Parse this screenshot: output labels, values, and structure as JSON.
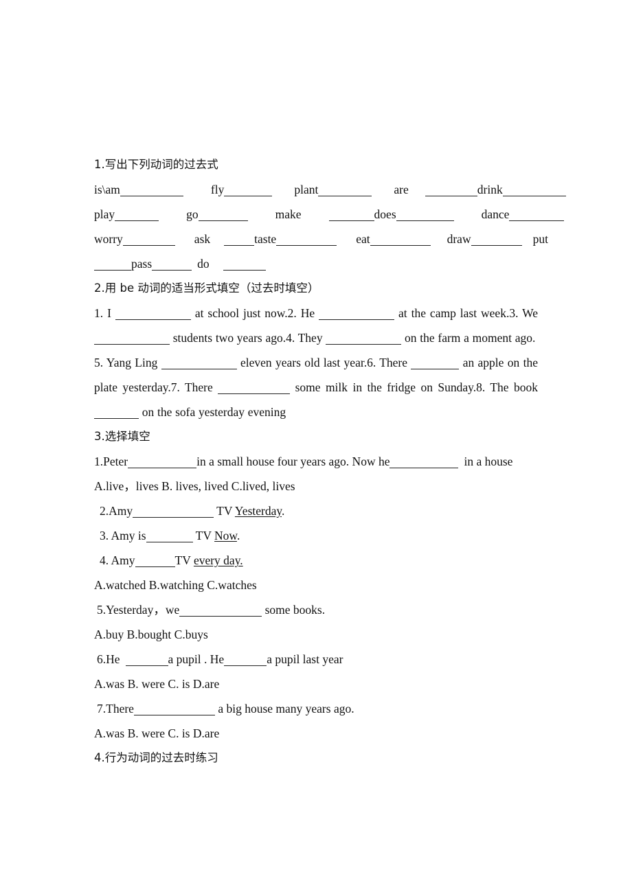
{
  "document": {
    "language": "zh-CN / en",
    "sections": [
      {
        "id": "section-1",
        "heading": "1.写出下列动词的过去式",
        "rows": [
          {
            "id": "verbs-row-1",
            "items": [
              "is\\am",
              "fly",
              "plant",
              "are",
              "drink"
            ]
          },
          {
            "id": "verbs-row-2",
            "items": [
              "play",
              "go",
              "make",
              "does",
              "dance"
            ]
          },
          {
            "id": "verbs-row-3",
            "items": [
              "worry",
              "ask",
              "taste",
              "eat",
              "draw",
              "put"
            ]
          },
          {
            "id": "verbs-row-4",
            "items": [
              "pass",
              "do"
            ]
          }
        ]
      },
      {
        "id": "section-2",
        "heading": "2.用 be 动词的适当形式填空（过去时填空）",
        "paragraphs": [
          {
            "id": "be-para-1",
            "parts": [
              {
                "t": "1. I"
              },
              {
                "blank": 110
              },
              {
                "t": "at school just now.2. He"
              },
              {
                "blank": 110
              },
              {
                "t": "at the camp last week.3. We"
              },
              {
                "blank": 110
              },
              {
                "t": "students two years ago.4. They"
              },
              {
                "blank": 110
              },
              {
                "t": "on the farm a moment ago."
              }
            ]
          },
          {
            "id": "be-para-2",
            "parts": [
              {
                "t": "5. Yang Ling"
              },
              {
                "blank": 110
              },
              {
                "t": "eleven years old last year.6. There"
              },
              {
                "blank": 70
              },
              {
                "t": "an apple on the plate yesterday.7. There"
              },
              {
                "blank": 105
              },
              {
                "t": "some milk in the fridge on Sunday.8. The book"
              },
              {
                "blank": 65
              },
              {
                "t": "on the sofa yesterday evening"
              }
            ]
          }
        ]
      },
      {
        "id": "section-3",
        "heading": "3.选择填空",
        "questions": [
          {
            "id": "q1",
            "stem_before": "1.Peter",
            "blank1": 100,
            "stem_mid": "in a small house four years ago. Now he",
            "blank2": 100,
            "stem_after": "in a house",
            "options": "A.live，lives   B. lives, lived   C.lived, lives"
          },
          {
            "id": "q2",
            "stem_before": "2.Amy",
            "blank1": 118,
            "stem_after_plain": " TV ",
            "stem_after_underlined": "Yesterday",
            "stem_tail": "."
          },
          {
            "id": "q3",
            "stem_before": "3. Amy is",
            "blank1": 68,
            "stem_after_plain": " TV ",
            "stem_after_underlined": "Now",
            "stem_tail": "."
          },
          {
            "id": "q4",
            "stem_before": "4. Amy",
            "blank1": 58,
            "stem_after_plain": "TV ",
            "stem_after_underlined": "every day.",
            "stem_tail": "",
            "options": "A.watched    B.watching    C.watches"
          },
          {
            "id": "q5",
            "stem_before": "5.Yesterday，we",
            "blank1": 120,
            "stem_after_plain": " some   books.",
            "options": "A.buy     B.bought     C.buys"
          },
          {
            "id": "q6",
            "stem_before": "6.He",
            "blank1": 62,
            "stem_mid": "a pupil . He",
            "blank2": 62,
            "stem_after": "a pupil last year",
            "options": "A.was    B. were    C. is     D.are"
          },
          {
            "id": "q7",
            "stem_before": "7.There",
            "blank1": 118,
            "stem_after": " a big house many years ago.",
            "options": "A.was   B. were   C. is      D.are"
          }
        ]
      },
      {
        "id": "section-4",
        "heading": "4.行为动词的过去时练习"
      }
    ]
  }
}
